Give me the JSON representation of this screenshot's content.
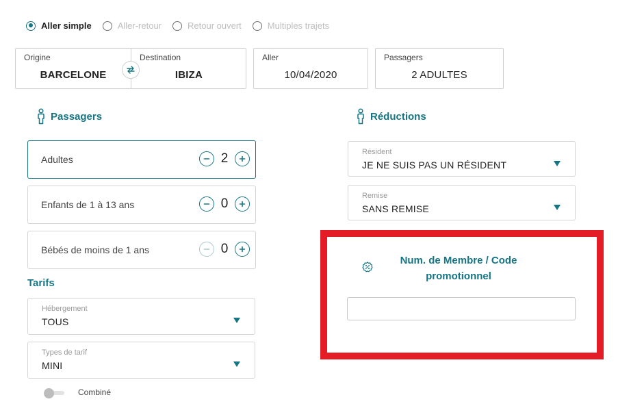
{
  "trip_types": [
    {
      "label": "Aller simple",
      "selected": true
    },
    {
      "label": "Aller-retour",
      "selected": false
    },
    {
      "label": "Retour ouvert",
      "selected": false
    },
    {
      "label": "Multiples trajets",
      "selected": false
    }
  ],
  "search": {
    "origin": {
      "label": "Origine",
      "value": "BARCELONE"
    },
    "destination": {
      "label": "Destination",
      "value": "IBIZA"
    },
    "outbound": {
      "label": "Aller",
      "value": "10/04/2020"
    },
    "passengers": {
      "label": "Passagers",
      "value": "2 ADULTES"
    }
  },
  "passengers_section": {
    "title": "Passagers",
    "rows": [
      {
        "label": "Adultes",
        "count": "2"
      },
      {
        "label": "Enfants de 1 à 13 ans",
        "count": "0"
      },
      {
        "label": "Bébés de moins de 1 ans",
        "count": "0"
      }
    ]
  },
  "tarifs": {
    "title": "Tarifs",
    "hebergement": {
      "label": "Hébergement",
      "value": "TOUS"
    },
    "types_de_tarif": {
      "label": "Types de tarif",
      "value": "MINI"
    },
    "combine": {
      "label": "Combiné",
      "on": false
    }
  },
  "reductions": {
    "title": "Réductions",
    "resident": {
      "label": "Résident",
      "value": "JE NE SUIS PAS UN RÉSIDENT"
    },
    "remise": {
      "label": "Remise",
      "value": "SANS REMISE"
    }
  },
  "promo": {
    "title": "Num. de Membre / Code promotionnel",
    "value": "",
    "icon": "percent-badge-icon"
  },
  "colors": {
    "accent": "#157584",
    "highlight": "#e41c26"
  }
}
